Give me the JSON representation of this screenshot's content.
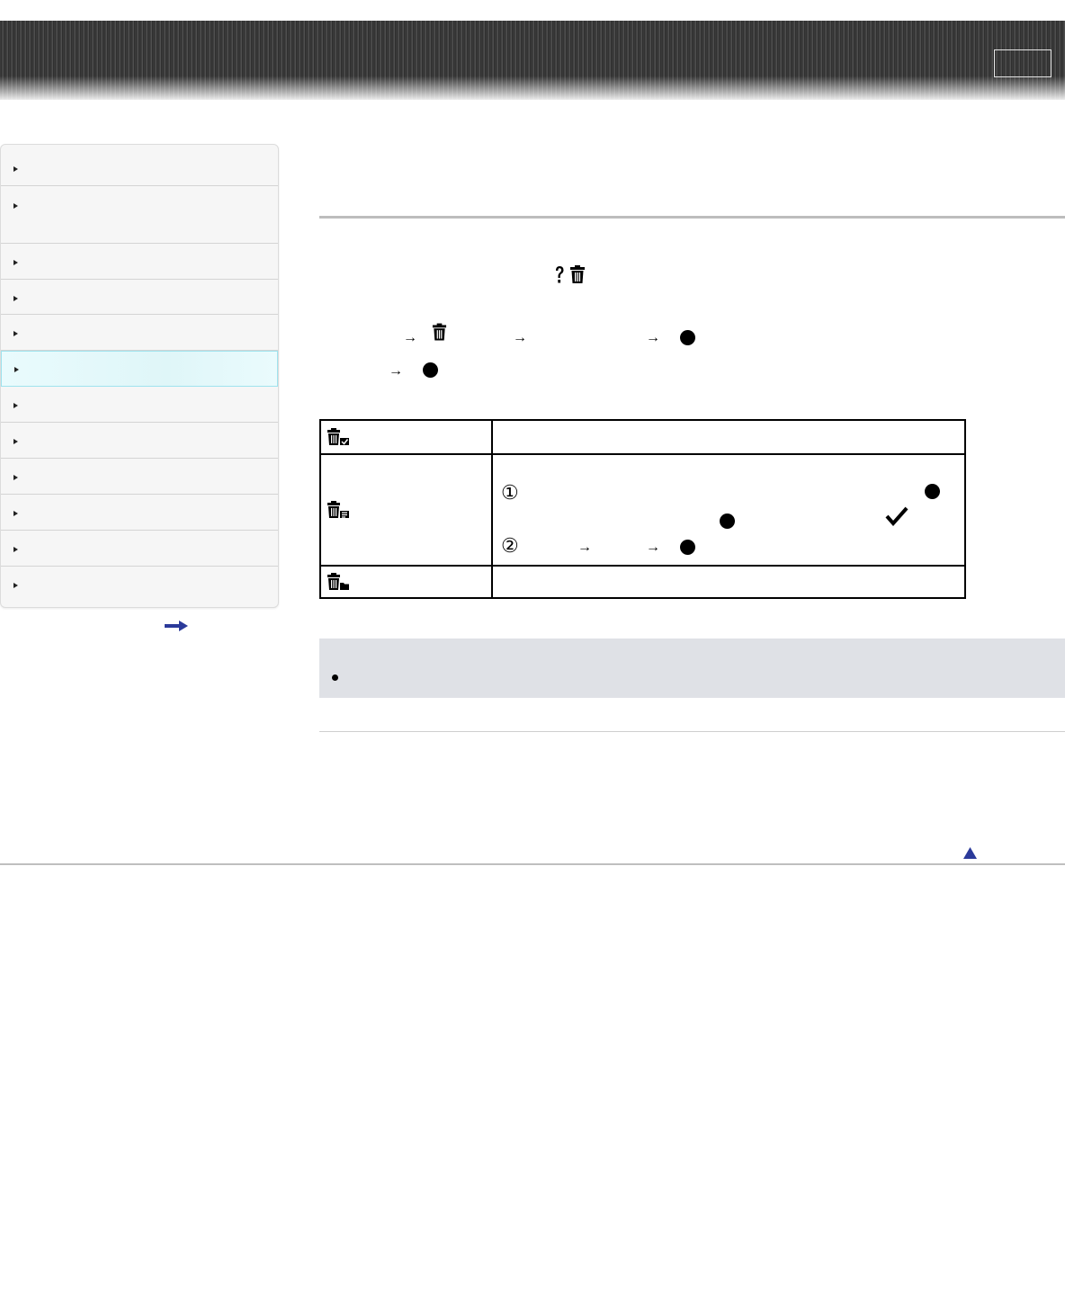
{
  "header": {
    "button_label": ""
  },
  "sidebar": {
    "items": [
      {
        "label": "",
        "active": false
      },
      {
        "label": "",
        "active": false
      },
      {
        "label": "",
        "active": false
      },
      {
        "label": "",
        "active": false
      },
      {
        "label": "",
        "active": false
      },
      {
        "label": "",
        "active": true
      },
      {
        "label": "",
        "active": false
      },
      {
        "label": "",
        "active": false
      },
      {
        "label": "",
        "active": false
      },
      {
        "label": "",
        "active": false
      },
      {
        "label": "",
        "active": false
      },
      {
        "label": "",
        "active": false
      }
    ],
    "more_icon": "right-arrow-icon"
  },
  "content": {
    "intro_icons": [
      "help-icon",
      "trash-icon"
    ],
    "step1_icons": [
      "arrow-right",
      "trash-icon",
      "arrow-right",
      "arrow-right",
      "filled-circle-icon"
    ],
    "step2_icons": [
      "arrow-right",
      "filled-circle-icon"
    ],
    "table": {
      "rows": [
        {
          "icon": "delete-all-icon",
          "text": ""
        },
        {
          "icon": "delete-multiple-icon",
          "steps": [
            {
              "marker": "①",
              "icons": [
                "filled-circle-icon",
                "filled-circle-icon",
                "check-icon"
              ]
            },
            {
              "marker": "②",
              "icons": [
                "arrow-right",
                "arrow-right",
                "filled-circle-icon"
              ]
            }
          ]
        },
        {
          "icon": "delete-folder-icon",
          "text": ""
        }
      ]
    },
    "note": {
      "bullet_text": ""
    }
  },
  "footer": {
    "back_to_top_icon": "up-triangle-icon"
  },
  "colors": {
    "active_nav": "#dff6f8",
    "active_border": "#9fe3ee",
    "note_bg": "#dfe1e6",
    "link_blue": "#2b3a9a"
  }
}
